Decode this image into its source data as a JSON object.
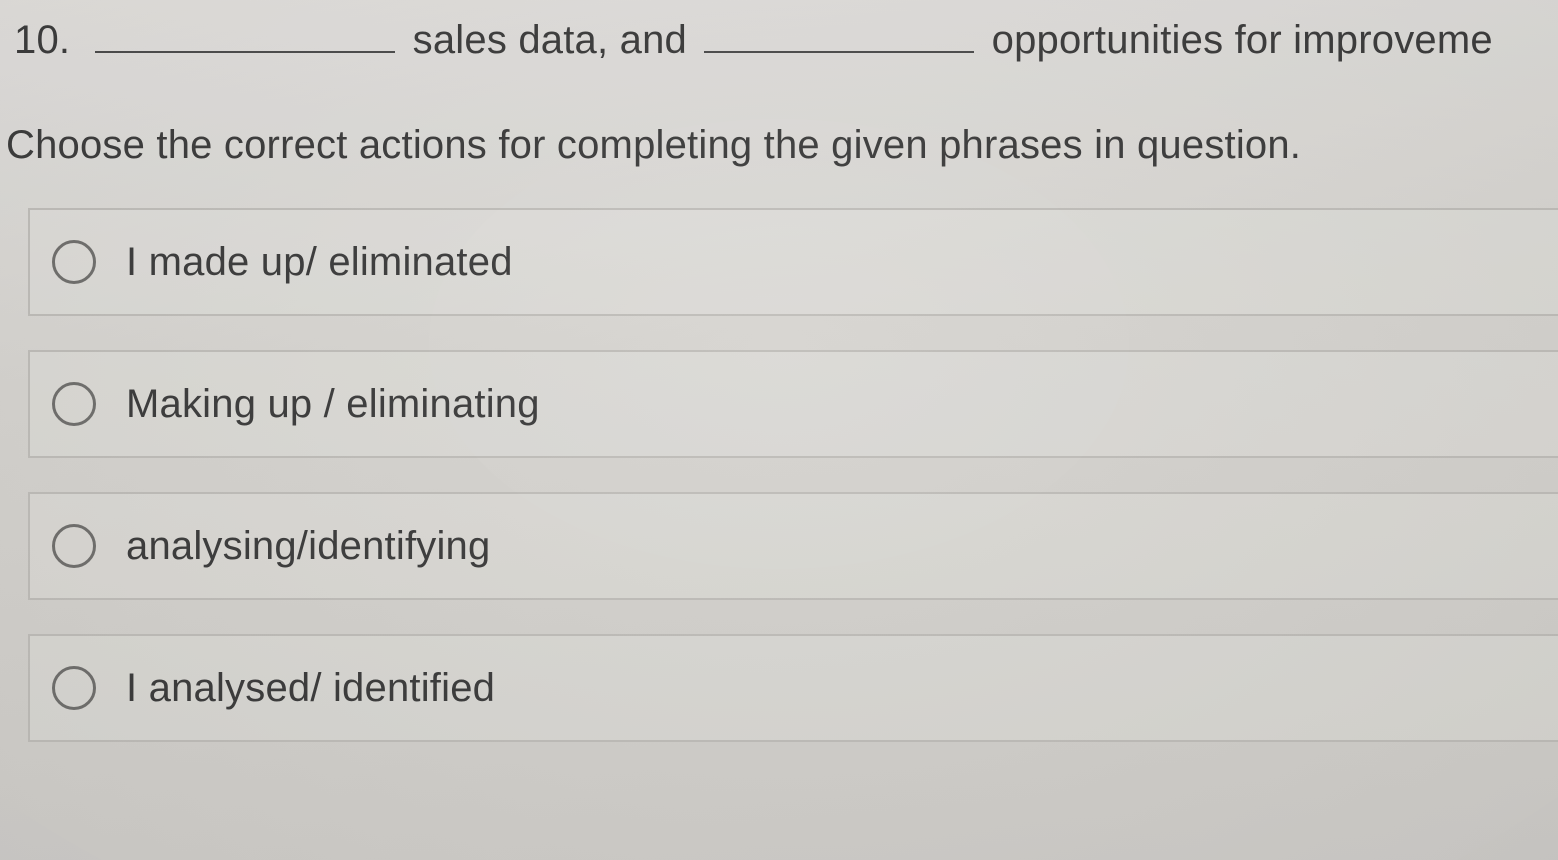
{
  "question": {
    "number": "10.",
    "segment1": "sales data, and",
    "segment2": "opportunities for improveme"
  },
  "instruction": "Choose the correct actions for completing the given phrases in question.",
  "options": [
    {
      "label": "I made up/ eliminated"
    },
    {
      "label": "Making up / eliminating"
    },
    {
      "label": "analysing/identifying"
    },
    {
      "label": "I analysed/ identified"
    }
  ]
}
